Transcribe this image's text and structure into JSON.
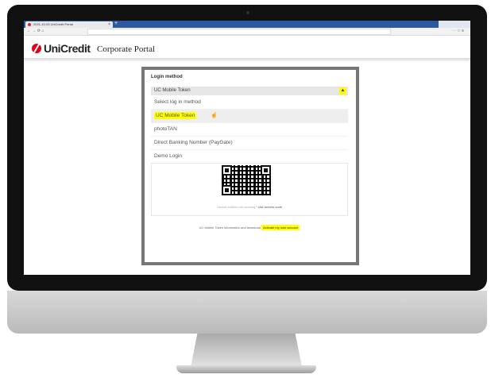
{
  "browser": {
    "tab_title": "2021-10-03 UniCredit Portal",
    "tab_close": "×",
    "new_tab": "+",
    "nav_buttons": "← → ⟳ ⌂"
  },
  "header": {
    "logo_text": "UniCredit",
    "portal_title": "Corporate Portal"
  },
  "login": {
    "title": "Login method",
    "selected_value": "UC Mobile Token",
    "chevron": "▲",
    "options": [
      "Select log in method",
      "UC Mobile Token",
      "photoTAN",
      "Direct Banking Number (PayGate)",
      "Demo Login"
    ],
    "qr_help_text": "Device method not working?",
    "qr_help_link": "Use access code",
    "info_text": "UC Mobile Token information and download",
    "info_link": "Activate my own account"
  },
  "colors": {
    "brand": "#e2001a",
    "highlight": "#ffff00",
    "panel_border": "#777777"
  }
}
